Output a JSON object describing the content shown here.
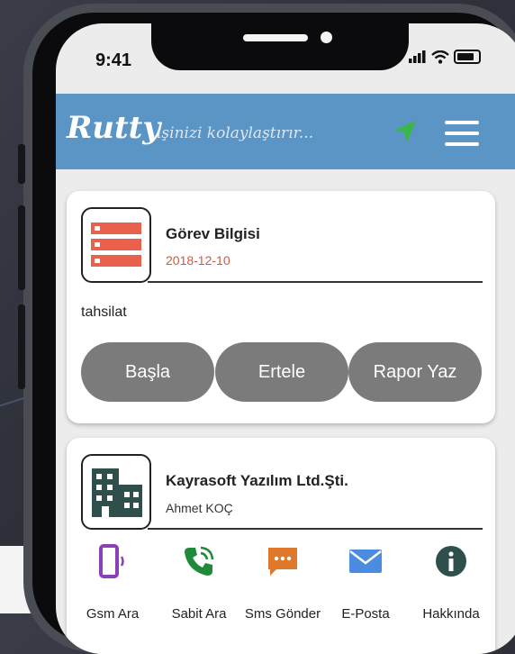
{
  "status": {
    "time": "9:41",
    "signal_icon": "signal-icon",
    "wifi_icon": "wifi-icon",
    "battery_icon": "battery-icon"
  },
  "appbar": {
    "logo": "Rutty",
    "tagline": "işinizi kolaylaştırır...",
    "color": "#5b95c6"
  },
  "task_card": {
    "title": "Görev Bilgisi",
    "date": "2018-12-10",
    "date_color": "#d4583f",
    "description": "tahsilat",
    "buttons": [
      {
        "label": "Başla"
      },
      {
        "label": "Ertele"
      },
      {
        "label": "Rapor Yaz"
      }
    ]
  },
  "customer_card": {
    "title": "Kayrasoft Yazılım Ltd.Şti.",
    "contact": "Ahmet KOÇ",
    "actions": [
      {
        "label": "Gsm Ara",
        "icon": "mobile-phone-icon",
        "color": "#8e3fb4"
      },
      {
        "label": "Sabit Ara",
        "icon": "phone-call-icon",
        "color": "#1f8a3a"
      },
      {
        "label": "Sms Gönder",
        "icon": "sms-icon",
        "color": "#e0782c"
      },
      {
        "label": "E-Posta",
        "icon": "mail-icon",
        "color": "#4a8de0"
      },
      {
        "label": "Hakkında",
        "icon": "info-icon",
        "color": "#2f4f4c"
      }
    ]
  }
}
